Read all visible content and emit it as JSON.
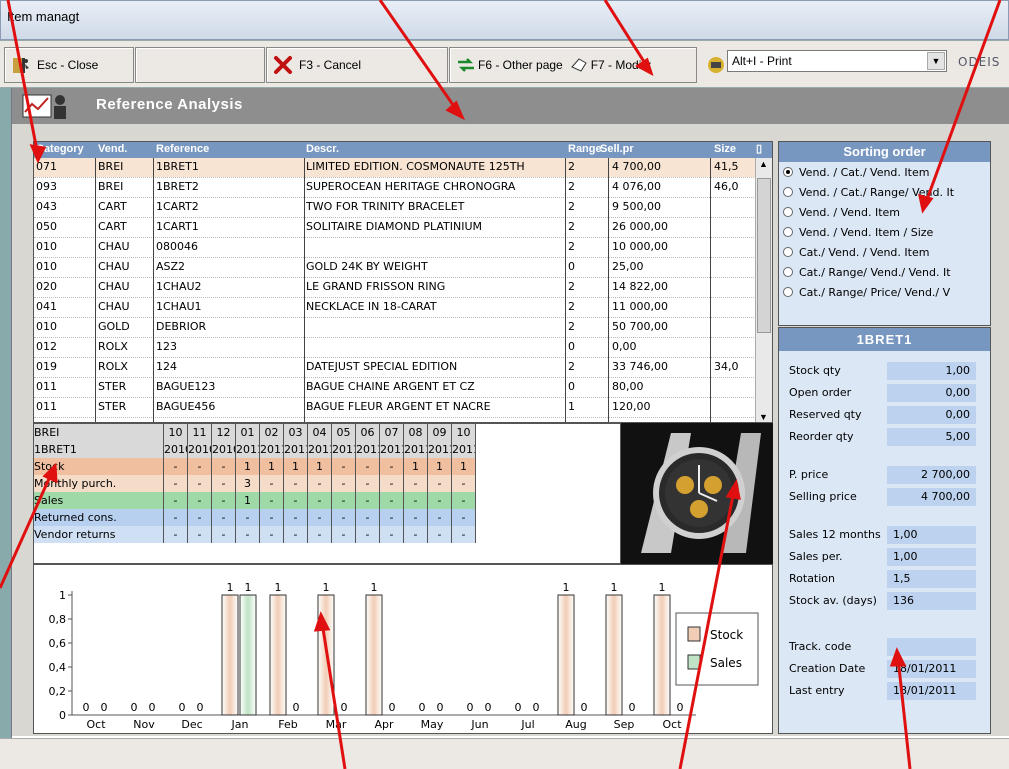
{
  "window": {
    "title": "Item managt"
  },
  "toolbar": {
    "close": "Esc - Close",
    "cancel": "F3 - Cancel",
    "other_page": "F6 - Other page",
    "modify": "F7 - Modify",
    "print_select": "Alt+I   - Print",
    "brand": "ODEIS"
  },
  "header": {
    "title": "Reference Analysis"
  },
  "grid": {
    "columns": [
      "Category",
      "Vend.",
      "Reference",
      "Descr.",
      "Range",
      "Sell.pr",
      "Size"
    ],
    "rows": [
      {
        "category": "071",
        "vend": "BREI",
        "reference": "1BRET1",
        "descr": "LIMITED EDITION. COSMONAUTE 125TH",
        "range": "2",
        "sell": "4 700,00",
        "size": "41,5"
      },
      {
        "category": "093",
        "vend": "BREI",
        "reference": "1BRET2",
        "descr": "SUPEROCEAN HERITAGE CHRONOGRA",
        "range": "2",
        "sell": "4 076,00",
        "size": "46,0"
      },
      {
        "category": "043",
        "vend": "CART",
        "reference": "1CART2",
        "descr": "TWO FOR TRINITY BRACELET",
        "range": "2",
        "sell": "9 500,00",
        "size": ""
      },
      {
        "category": "050",
        "vend": "CART",
        "reference": "1CART1",
        "descr": "SOLITAIRE DIAMOND PLATINIUM",
        "range": "2",
        "sell": "26 000,00",
        "size": ""
      },
      {
        "category": "010",
        "vend": "CHAU",
        "reference": "080046",
        "descr": "",
        "range": "2",
        "sell": "10 000,00",
        "size": ""
      },
      {
        "category": "010",
        "vend": "CHAU",
        "reference": "ASZ2",
        "descr": "GOLD 24K BY WEIGHT",
        "range": "0",
        "sell": "25,00",
        "size": ""
      },
      {
        "category": "020",
        "vend": "CHAU",
        "reference": "1CHAU2",
        "descr": "LE GRAND FRISSON RING",
        "range": "2",
        "sell": "14 822,00",
        "size": ""
      },
      {
        "category": "041",
        "vend": "CHAU",
        "reference": "1CHAU1",
        "descr": "NECKLACE IN 18-CARAT",
        "range": "2",
        "sell": "11 000,00",
        "size": ""
      },
      {
        "category": "010",
        "vend": "GOLD",
        "reference": "DEBRIOR",
        "descr": "",
        "range": "2",
        "sell": "50 700,00",
        "size": ""
      },
      {
        "category": "012",
        "vend": "ROLX",
        "reference": "123",
        "descr": "",
        "range": "0",
        "sell": "0,00",
        "size": ""
      },
      {
        "category": "019",
        "vend": "ROLX",
        "reference": "124",
        "descr": "DATEJUST SPECIAL EDITION",
        "range": "2",
        "sell": "33 746,00",
        "size": "34,0"
      },
      {
        "category": "011",
        "vend": "STER",
        "reference": "BAGUE123",
        "descr": "BAGUE CHAINE ARGENT ET CZ",
        "range": "0",
        "sell": "80,00",
        "size": ""
      },
      {
        "category": "011",
        "vend": "STER",
        "reference": "BAGUE456",
        "descr": "BAGUE FLEUR ARGENT ET NACRE",
        "range": "1",
        "sell": "120,00",
        "size": ""
      }
    ]
  },
  "history": {
    "vendor": "BREI",
    "reference": "1BRET1",
    "months": [
      "10",
      "11",
      "12",
      "01",
      "02",
      "03",
      "04",
      "05",
      "06",
      "07",
      "08",
      "09",
      "10"
    ],
    "years": [
      "2010",
      "2010",
      "2010",
      "2011",
      "2011",
      "2011",
      "2011",
      "2011",
      "2011",
      "2011",
      "2011",
      "2011",
      "2011"
    ],
    "rows": [
      {
        "label": "Stock",
        "color": "#efbfa0",
        "values": [
          "-",
          "-",
          "-",
          "1",
          "1",
          "1",
          "1",
          "-",
          "-",
          "-",
          "1",
          "1",
          "1"
        ]
      },
      {
        "label": "Monthly purch.",
        "color": "#f5dcc8",
        "values": [
          "-",
          "-",
          "-",
          "3",
          "-",
          "-",
          "-",
          "-",
          "-",
          "-",
          "-",
          "-",
          "-"
        ]
      },
      {
        "label": "Sales",
        "color": "#9fd9a8",
        "values": [
          "-",
          "-",
          "-",
          "1",
          "-",
          "-",
          "-",
          "-",
          "-",
          "-",
          "-",
          "-",
          "-"
        ]
      },
      {
        "label": "Returned cons.",
        "color": "#b8d0f0",
        "values": [
          "-",
          "-",
          "-",
          "-",
          "-",
          "-",
          "-",
          "-",
          "-",
          "-",
          "-",
          "-",
          "-"
        ]
      },
      {
        "label": "Vendor returns",
        "color": "#cfe0f5",
        "values": [
          "-",
          "-",
          "-",
          "-",
          "-",
          "-",
          "-",
          "-",
          "-",
          "-",
          "-",
          "-",
          "-"
        ]
      }
    ]
  },
  "chart_data": {
    "type": "bar",
    "categories": [
      "Oct",
      "Nov",
      "Dec",
      "Jan",
      "Feb",
      "Mar",
      "Apr",
      "May",
      "Jun",
      "Jul",
      "Aug",
      "Sep",
      "Oct"
    ],
    "series": [
      {
        "name": "Stock",
        "color": "#f1cdb5",
        "values": [
          0,
          0,
          0,
          1,
          1,
          1,
          1,
          0,
          0,
          0,
          1,
          1,
          1
        ]
      },
      {
        "name": "Sales",
        "color": "#bfe3c4",
        "values": [
          0,
          0,
          0,
          1,
          0,
          0,
          0,
          0,
          0,
          0,
          0,
          0,
          0
        ]
      }
    ],
    "ylim": [
      0,
      1
    ],
    "yticks": [
      "0",
      "0,2",
      "0,4",
      "0,6",
      "0,8",
      "1"
    ],
    "legend": "right"
  },
  "sorting": {
    "title": "Sorting order",
    "options": [
      "Vend. / Cat./ Vend. Item",
      "Vend. / Cat./ Range/ Vend. It",
      "Vend. / Vend. Item",
      "Vend. / Vend. Item / Size",
      "Cat./ Vend. / Vend. Item",
      "Cat./ Range/ Vend./ Vend. It",
      "Cat./ Range/ Price/ Vend./ V"
    ],
    "selected": 0
  },
  "info": {
    "title": "1BRET1",
    "fields": [
      {
        "label": "Stock qty",
        "value": "1,00"
      },
      {
        "label": "Open order",
        "value": "0,00"
      },
      {
        "label": "Reserved qty",
        "value": "0,00"
      },
      {
        "label": "Reorder qty",
        "value": "5,00"
      },
      {
        "label": "P. price",
        "value": "2 700,00"
      },
      {
        "label": "Selling price",
        "value": "4 700,00"
      },
      {
        "label": "Sales 12 months",
        "value": "1,00"
      },
      {
        "label": "Sales per.",
        "value": "1,00"
      },
      {
        "label": "Rotation",
        "value": "1,5"
      },
      {
        "label": "Stock av. (days)",
        "value": "136"
      },
      {
        "label": "Track. code",
        "value": ""
      },
      {
        "label": "Creation Date",
        "value": "18/01/2011"
      },
      {
        "label": "Last entry",
        "value": "18/01/2011"
      }
    ]
  }
}
